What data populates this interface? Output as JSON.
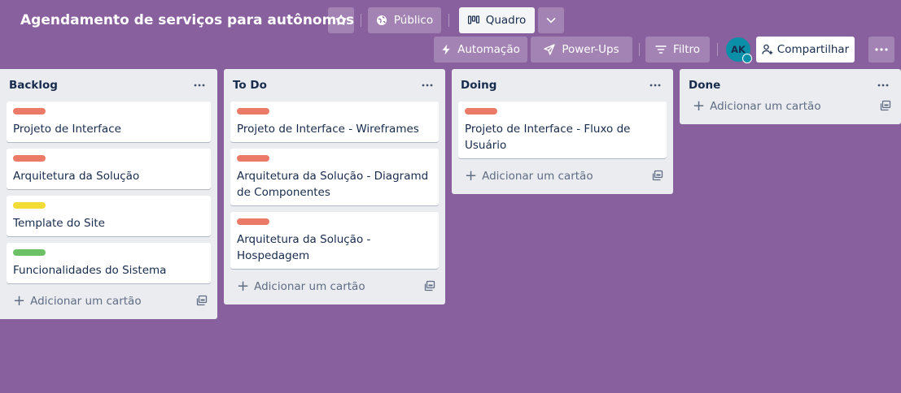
{
  "header": {
    "board_title": "Agendamento de serviços para autônomos",
    "visibility_label": "Público",
    "view_label": "Quadro",
    "automation_label": "Automação",
    "powerups_label": "Power-Ups",
    "filter_label": "Filtro",
    "avatar_initials": "AK",
    "share_label": "Compartilhar"
  },
  "add_card_label": "Adicionar um cartão",
  "colors": {
    "background": "#89609e",
    "label_red": "#eb7a67",
    "label_yellow": "#f2dd36",
    "label_green": "#6cc164"
  },
  "lists": [
    {
      "title": "Backlog",
      "cards": [
        {
          "label_color": "#eb7a67",
          "title": "Projeto de Interface"
        },
        {
          "label_color": "#eb7a67",
          "title": "Arquitetura da Solução"
        },
        {
          "label_color": "#f2dd36",
          "title": "Template do Site"
        },
        {
          "label_color": "#6cc164",
          "title": "Funcionalidades do Sistema"
        }
      ]
    },
    {
      "title": "To Do",
      "cards": [
        {
          "label_color": "#eb7a67",
          "title": "Projeto de Interface - Wireframes"
        },
        {
          "label_color": "#eb7a67",
          "title": "Arquitetura da Solução - Diagramd de Componentes"
        },
        {
          "label_color": "#eb7a67",
          "title": "Arquitetura da Solução - Hospedagem"
        }
      ]
    },
    {
      "title": "Doing",
      "cards": [
        {
          "label_color": "#eb7a67",
          "title": "Projeto de Interface - Fluxo de Usuário"
        }
      ]
    },
    {
      "title": "Done",
      "cards": []
    }
  ]
}
